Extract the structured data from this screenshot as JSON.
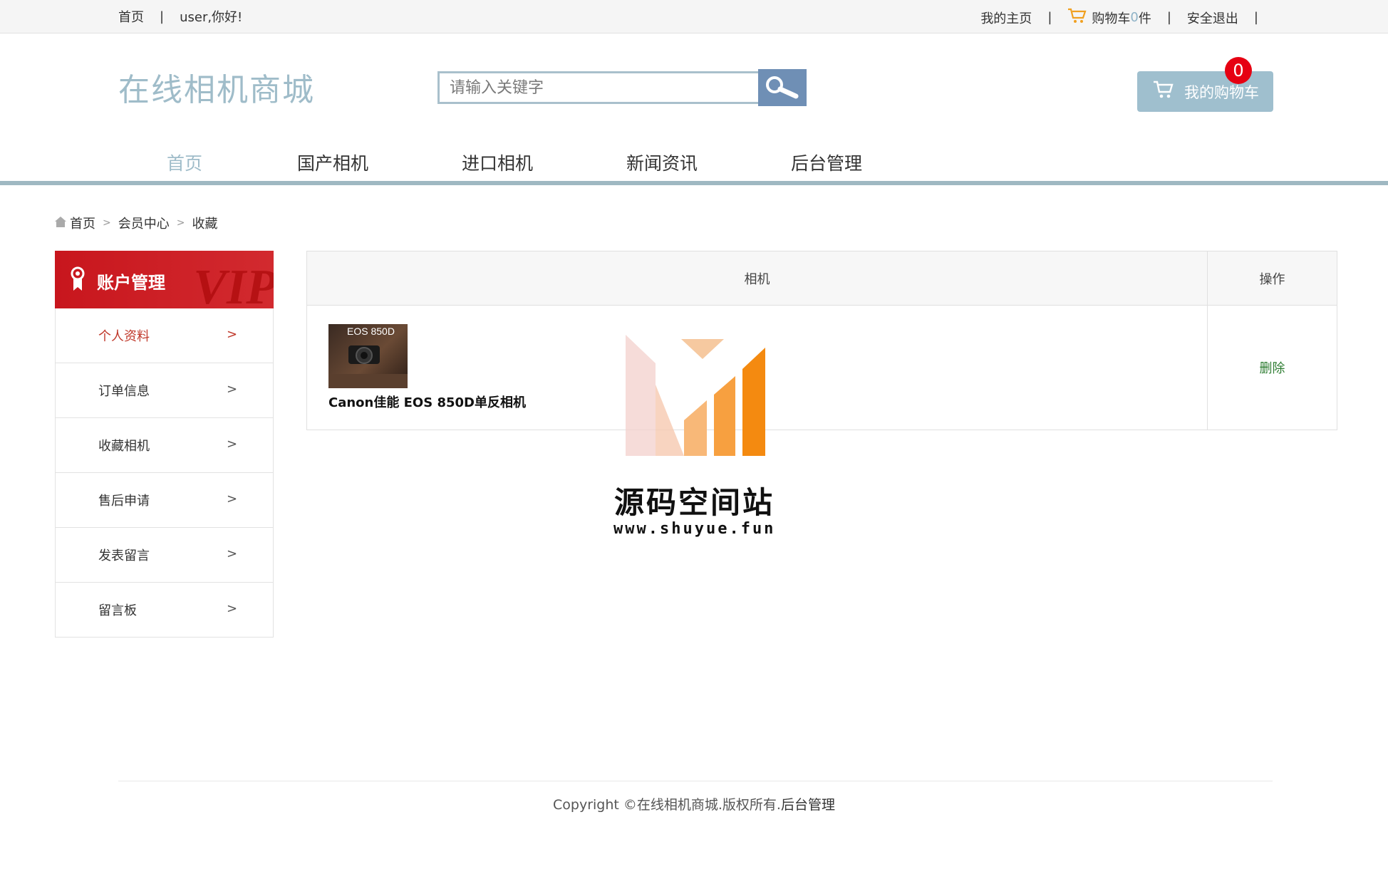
{
  "topbar": {
    "home": "首页",
    "greeting": "user,你好!",
    "my_home": "我的主页",
    "cart_prefix": "购物车",
    "cart_count": "0",
    "cart_suffix": "件",
    "logout": "安全退出",
    "sep": "|"
  },
  "header": {
    "logo": "在线相机商城",
    "search_placeholder": "请输入关键字",
    "my_cart": "我的购物车",
    "cart_badge": "0"
  },
  "nav": {
    "items": [
      "首页",
      "国产相机",
      "进口相机",
      "新闻资讯",
      "后台管理"
    ]
  },
  "breadcrumb": {
    "home": "首页",
    "member": "会员中心",
    "current": "收藏",
    "gt": ">"
  },
  "sidebar": {
    "title": "账户管理",
    "vip": "VIP",
    "chev": ">",
    "items": [
      "个人资料",
      "订单信息",
      "收藏相机",
      "售后申请",
      "发表留言",
      "留言板"
    ]
  },
  "table": {
    "headers": [
      "相机",
      "操作"
    ],
    "rows": [
      {
        "image_text": "EOS 850D",
        "name": "Canon佳能 EOS 850D单反相机",
        "action": "删除"
      }
    ]
  },
  "watermark": {
    "title": "源码空间站",
    "url": "www.shuyue.fun"
  },
  "footer": {
    "copyright": "Copyright ©在线相机商城.版权所有.",
    "admin_link": "后台管理"
  },
  "colors": {
    "accent": "#9fbcc9",
    "sidebar_red": "#c8161d",
    "badge_red": "#e60012",
    "delete_green": "#2e7d32"
  }
}
